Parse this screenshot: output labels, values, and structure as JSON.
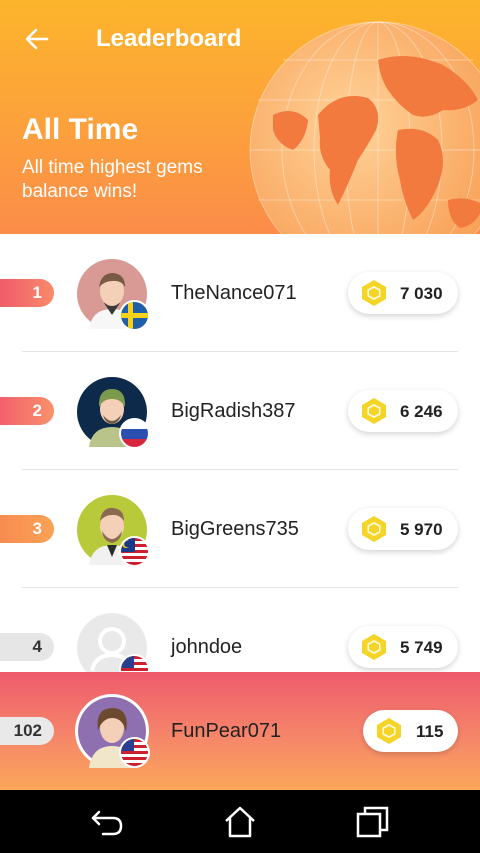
{
  "header": {
    "title": "Leaderboard",
    "heading": "All Time",
    "subtitle": "All time highest gems balance wins!",
    "back_icon": "arrow-left-icon",
    "background_icon": "globe-icon"
  },
  "leaderboard": {
    "rows": [
      {
        "rank": "1",
        "username": "TheNance071",
        "gems": "7 030",
        "flag": "sweden-flag-icon"
      },
      {
        "rank": "2",
        "username": "BigRadish387",
        "gems": "6 246",
        "flag": "russia-flag-icon"
      },
      {
        "rank": "3",
        "username": "BigGreens735",
        "gems": "5 970",
        "flag": "malaysia-flag-icon"
      },
      {
        "rank": "4",
        "username": "johndoe",
        "gems": "5 749",
        "flag": "usa-flag-icon"
      }
    ]
  },
  "current_user": {
    "rank": "102",
    "username": "FunPear071",
    "gems": "115",
    "flag": "usa-flag-icon"
  },
  "navbar": {
    "icons": [
      "back-icon",
      "home-icon",
      "recent-apps-icon"
    ]
  },
  "colors": {
    "header_top": "#fdb52c",
    "header_bottom": "#fb8c4a",
    "gem": "#f5d428",
    "current_user_bar": "#ee5a6c"
  }
}
